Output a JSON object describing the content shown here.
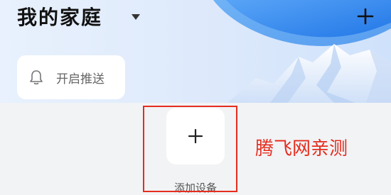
{
  "header": {
    "title": "我的家庭",
    "dropdown_icon": "caret-down-icon",
    "add_icon": "plus-icon"
  },
  "push_card": {
    "icon": "bell-icon",
    "label": "开启推送"
  },
  "add_device": {
    "icon": "plus-icon",
    "label": "添加设备"
  },
  "annotation": {
    "watermark": "腾飞网亲测",
    "highlight_color": "#e52d1f"
  },
  "colors": {
    "background": "#f2f3f5",
    "header_gradient": "#dde9fb",
    "sky_blue": "#2f86f0",
    "card": "#ffffff"
  }
}
